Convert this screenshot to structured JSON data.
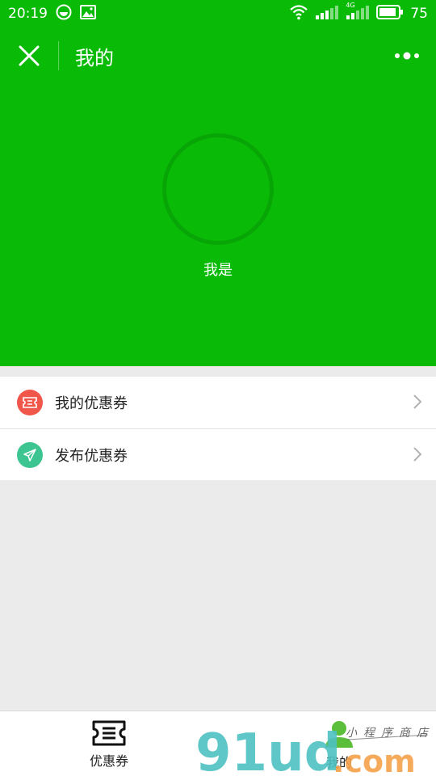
{
  "status_bar": {
    "time": "20:19",
    "battery": "75",
    "network_label": "4G"
  },
  "nav": {
    "title": "我的"
  },
  "profile": {
    "name": "我是"
  },
  "menu": {
    "items": [
      {
        "label": "我的优惠券",
        "icon": "ticket-icon",
        "color": "#f0574a"
      },
      {
        "label": "发布优惠券",
        "icon": "paper-plane-icon",
        "color": "#3cc591"
      }
    ]
  },
  "tabbar": {
    "tabs": [
      {
        "label": "优惠券",
        "icon": "ticket-icon"
      },
      {
        "label": "我的",
        "icon": "user-icon"
      }
    ]
  },
  "watermark": {
    "brand": "91ud",
    "suffix": ".com",
    "tagline": "小程序商店"
  },
  "colors": {
    "primary": "#09bb07",
    "avatar_ring": "#08a506",
    "watermark_teal": "#4ec2c2",
    "watermark_orange": "#f5a24a",
    "watermark_green": "#5bbf3c"
  }
}
